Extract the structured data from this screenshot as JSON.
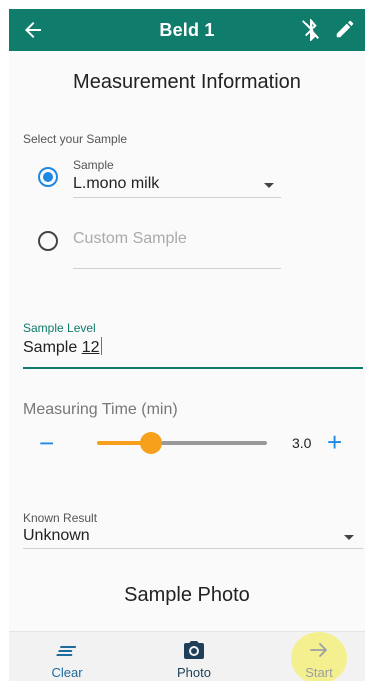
{
  "appbar": {
    "title": "Beld 1",
    "back_icon": "arrow-left-icon",
    "bluetooth_icon": "bluetooth-disabled-icon",
    "edit_icon": "pencil-icon",
    "color": "#0f7c6c"
  },
  "form": {
    "heading": "Measurement Information",
    "select_sample_label": "Select your Sample",
    "sample": {
      "caption": "Sample",
      "value": "L.mono milk",
      "selected": true
    },
    "custom_sample": {
      "placeholder": "Custom Sample",
      "selected": false
    },
    "sample_level": {
      "caption": "Sample Level",
      "value_prefix": "Sample ",
      "value_number": "12"
    },
    "measuring_time": {
      "label": "Measuring Time (min)",
      "value": "3.0",
      "min": 0,
      "max": 10,
      "current": 3.0,
      "minus_label": "−",
      "plus_label": "+"
    },
    "known_result": {
      "caption": "Known Result",
      "value": "Unknown"
    },
    "photo_heading": "Sample Photo"
  },
  "bottombar": {
    "clear_label": "Clear",
    "photo_label": "Photo",
    "start_label": "Start",
    "accent_blue": "#1e88e5",
    "slider_color": "#f7a01c"
  }
}
